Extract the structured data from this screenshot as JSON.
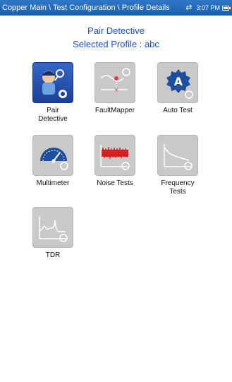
{
  "titlebar": {
    "path": "Copper Main \\ Test Configuration \\ Profile Details",
    "time": "3:07 PM"
  },
  "header": {
    "title": "Pair Detective",
    "subtitle": "Selected Profile : abc"
  },
  "tiles": [
    {
      "label_line1": "Pair",
      "label_line2": "Detective",
      "icon": "pair-detective-icon"
    },
    {
      "label_line1": "FaultMapper",
      "label_line2": "",
      "icon": "faultmapper-icon"
    },
    {
      "label_line1": "Auto Test",
      "label_line2": "",
      "icon": "auto-test-icon"
    },
    {
      "label_line1": "Multimeter",
      "label_line2": "",
      "icon": "multimeter-icon"
    },
    {
      "label_line1": "Noise Tests",
      "label_line2": "",
      "icon": "noise-tests-icon"
    },
    {
      "label_line1": "Frequency",
      "label_line2": "Tests",
      "icon": "frequency-tests-icon"
    },
    {
      "label_line1": "TDR",
      "label_line2": "",
      "icon": "tdr-icon"
    }
  ],
  "colors": {
    "titlebar": "#1b5fae",
    "header_text": "#1a4fd6",
    "tile_bg": "#c9c9c9",
    "active_tile_bg": "#1b3f96"
  }
}
